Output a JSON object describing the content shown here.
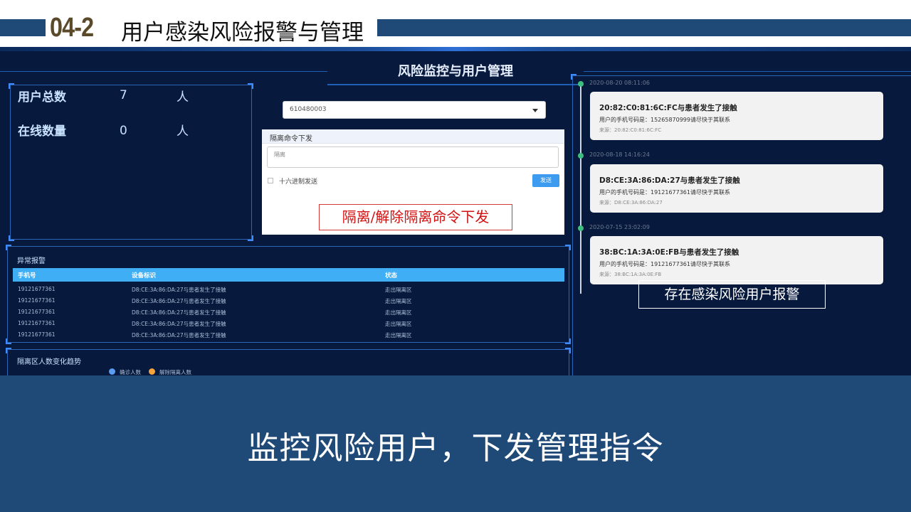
{
  "header": {
    "section_number": "04-2",
    "title": "用户感染风险报警与管理"
  },
  "dashboard": {
    "title": "风险监控与用户管理",
    "stats": [
      {
        "label": "用户总数",
        "value": "7",
        "unit": "人"
      },
      {
        "label": "在线数量",
        "value": "0",
        "unit": "人"
      }
    ],
    "device_select": {
      "value": "610480003"
    },
    "command": {
      "title": "隔离命令下发",
      "input_placeholder": "隔离",
      "hex_checkbox_label": "十六进制发送",
      "send_label": "发送"
    },
    "alert_table": {
      "title": "异常报警",
      "columns": [
        "手机号",
        "设备标识",
        "状态"
      ],
      "rows": [
        [
          "19121677361",
          "D8:CE:3A:86:DA:27与患者发生了接触",
          "走出隔离区"
        ],
        [
          "19121677361",
          "D8:CE:3A:86:DA:27与患者发生了接触",
          "走出隔离区"
        ],
        [
          "19121677361",
          "D8:CE:3A:86:DA:27与患者发生了接触",
          "走出隔离区"
        ],
        [
          "19121677361",
          "D8:CE:3A:86:DA:27与患者发生了接触",
          "走出隔离区"
        ],
        [
          "19121677361",
          "D8:CE:3A:86:DA:27与患者发生了接触",
          "走出隔离区"
        ]
      ]
    },
    "trend": {
      "title": "隔离区人数变化趋势",
      "legend": [
        {
          "label": "确诊人数",
          "color": "#5b9cf0"
        },
        {
          "label": "解除隔离人数",
          "color": "#f5a33a"
        }
      ]
    },
    "timeline": [
      {
        "time": "2020-08-20 08:11:06",
        "head": "20:82:C0:81:6C:FC与患者发生了接触",
        "body": "用户的手机号码是：15265870999请尽快于其联系",
        "source": "来源：20:82:C0:81:6C:FC"
      },
      {
        "time": "2020-08-18 14:16:24",
        "head": "D8:CE:3A:86:DA:27与患者发生了接触",
        "body": "用户的手机号码是：19121677361请尽快于其联系",
        "source": "来源：D8:CE:3A:86:DA:27"
      },
      {
        "time": "2020-07-15 23:02:09",
        "head": "38:BC:1A:3A:0E:FB与患者发生了接触",
        "body": "用户的手机号码是：19121677361请尽快于其联系",
        "source": "来源：38:BC:1A:3A:0E:FB"
      }
    ]
  },
  "annotations": {
    "command_note": "隔离/解除隔离命令下发",
    "alert_note": "存在感染风险用户报警"
  },
  "footer": {
    "caption": "监控风险用户，下发管理指令"
  },
  "colors": {
    "brand_blue": "#1f4a78",
    "dashboard_bg": "#071a3d",
    "accent_blue": "#3faef5",
    "timeline_dot": "#3fbf7f"
  }
}
